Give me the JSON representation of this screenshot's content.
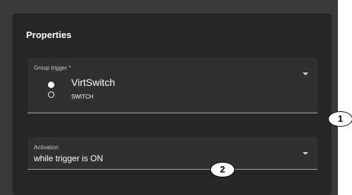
{
  "panel": {
    "title": "Properties"
  },
  "group_trigger": {
    "label": "Group trigger *",
    "selected_name": "VirtSwitch",
    "selected_type": "SWITCH"
  },
  "activation": {
    "label": "Activation",
    "value": "while trigger is ON"
  },
  "callouts": [
    "1",
    "2"
  ],
  "colors": {
    "card_bg": "#262626",
    "field_bg": "#303030",
    "outer_bg": "#3a3a3a"
  }
}
